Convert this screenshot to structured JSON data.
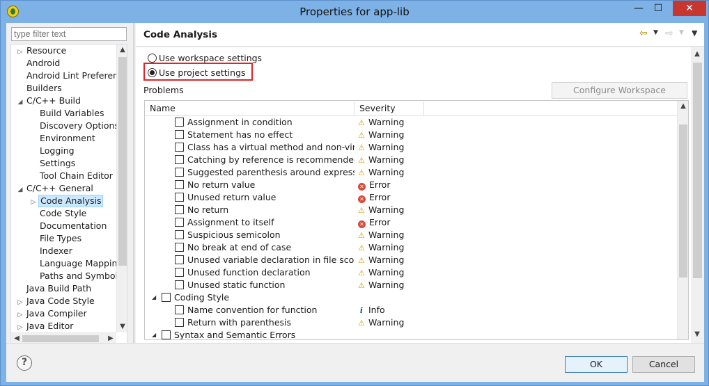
{
  "window": {
    "title": "Properties for app-lib",
    "minimize": "—",
    "maximize": "☐",
    "close": "✕"
  },
  "filter": {
    "placeholder": "type filter text"
  },
  "tree": [
    {
      "label": "Resource",
      "indent": 0,
      "arrow": "▷",
      "selected": false
    },
    {
      "label": "Android",
      "indent": 0,
      "arrow": "",
      "selected": false
    },
    {
      "label": "Android Lint Preferen",
      "indent": 0,
      "arrow": "",
      "selected": false
    },
    {
      "label": "Builders",
      "indent": 0,
      "arrow": "",
      "selected": false
    },
    {
      "label": "C/C++ Build",
      "indent": 0,
      "arrow": "◢",
      "selected": false
    },
    {
      "label": "Build Variables",
      "indent": 1,
      "arrow": "",
      "selected": false
    },
    {
      "label": "Discovery Options",
      "indent": 1,
      "arrow": "",
      "selected": false
    },
    {
      "label": "Environment",
      "indent": 1,
      "arrow": "",
      "selected": false
    },
    {
      "label": "Logging",
      "indent": 1,
      "arrow": "",
      "selected": false
    },
    {
      "label": "Settings",
      "indent": 1,
      "arrow": "",
      "selected": false
    },
    {
      "label": "Tool Chain Editor",
      "indent": 1,
      "arrow": "",
      "selected": false
    },
    {
      "label": "C/C++ General",
      "indent": 0,
      "arrow": "◢",
      "selected": false
    },
    {
      "label": "Code Analysis",
      "indent": 1,
      "arrow": "▷",
      "selected": true
    },
    {
      "label": "Code Style",
      "indent": 1,
      "arrow": "",
      "selected": false
    },
    {
      "label": "Documentation",
      "indent": 1,
      "arrow": "",
      "selected": false
    },
    {
      "label": "File Types",
      "indent": 1,
      "arrow": "",
      "selected": false
    },
    {
      "label": "Indexer",
      "indent": 1,
      "arrow": "",
      "selected": false
    },
    {
      "label": "Language Mappin",
      "indent": 1,
      "arrow": "",
      "selected": false
    },
    {
      "label": "Paths and Symbol",
      "indent": 1,
      "arrow": "",
      "selected": false
    },
    {
      "label": "Java Build Path",
      "indent": 0,
      "arrow": "",
      "selected": false
    },
    {
      "label": "Java Code Style",
      "indent": 0,
      "arrow": "▷",
      "selected": false
    },
    {
      "label": "Java Compiler",
      "indent": 0,
      "arrow": "▷",
      "selected": false
    },
    {
      "label": "Java Editor",
      "indent": 0,
      "arrow": "▷",
      "selected": false
    }
  ],
  "page": {
    "title": "Code Analysis"
  },
  "settings": {
    "workspace_label": "Use workspace settings",
    "project_label": "Use project settings",
    "selected": "project",
    "configure_button": "Configure Workspace Settings..."
  },
  "problems": {
    "label": "Problems",
    "columns": {
      "name": "Name",
      "severity": "Severity"
    },
    "rows": [
      {
        "type": "item",
        "name": "Assignment in condition",
        "severity": "Warning",
        "level": "warning"
      },
      {
        "type": "item",
        "name": "Statement has no effect",
        "severity": "Warning",
        "level": "warning"
      },
      {
        "type": "item",
        "name": "Class has a virtual method and non-virtual destructor",
        "severity": "Warning",
        "level": "warning"
      },
      {
        "type": "item",
        "name": "Catching by reference is recommended",
        "severity": "Warning",
        "level": "warning"
      },
      {
        "type": "item",
        "name": "Suggested parenthesis around expression",
        "severity": "Warning",
        "level": "warning"
      },
      {
        "type": "item",
        "name": "No return value",
        "severity": "Error",
        "level": "error"
      },
      {
        "type": "item",
        "name": "Unused return value",
        "severity": "Error",
        "level": "error"
      },
      {
        "type": "item",
        "name": "No return",
        "severity": "Warning",
        "level": "warning"
      },
      {
        "type": "item",
        "name": "Assignment to itself",
        "severity": "Error",
        "level": "error"
      },
      {
        "type": "item",
        "name": "Suspicious semicolon",
        "severity": "Warning",
        "level": "warning"
      },
      {
        "type": "item",
        "name": "No break at end of case",
        "severity": "Warning",
        "level": "warning"
      },
      {
        "type": "item",
        "name": "Unused variable declaration in file scope",
        "severity": "Warning",
        "level": "warning"
      },
      {
        "type": "item",
        "name": "Unused function declaration",
        "severity": "Warning",
        "level": "warning"
      },
      {
        "type": "item",
        "name": "Unused static function",
        "severity": "Warning",
        "level": "warning"
      },
      {
        "type": "group",
        "name": "Coding Style",
        "severity": "",
        "level": ""
      },
      {
        "type": "item",
        "name": "Name convention for function",
        "severity": "Info",
        "level": "info"
      },
      {
        "type": "item",
        "name": "Return with parenthesis",
        "severity": "Warning",
        "level": "warning"
      },
      {
        "type": "group",
        "name": "Syntax and Semantic Errors",
        "severity": "",
        "level": ""
      }
    ]
  },
  "buttons": {
    "help": "?",
    "ok": "OK",
    "cancel": "Cancel"
  },
  "icons": {
    "warning": "⚠",
    "error": "✕",
    "info": "i",
    "back": "⇦",
    "forward": "⇨",
    "dropdown": "▼"
  },
  "colors": {
    "highlight": "#e0242a",
    "selection": "#cce8ff",
    "title_bar": "#7eb2e6"
  }
}
